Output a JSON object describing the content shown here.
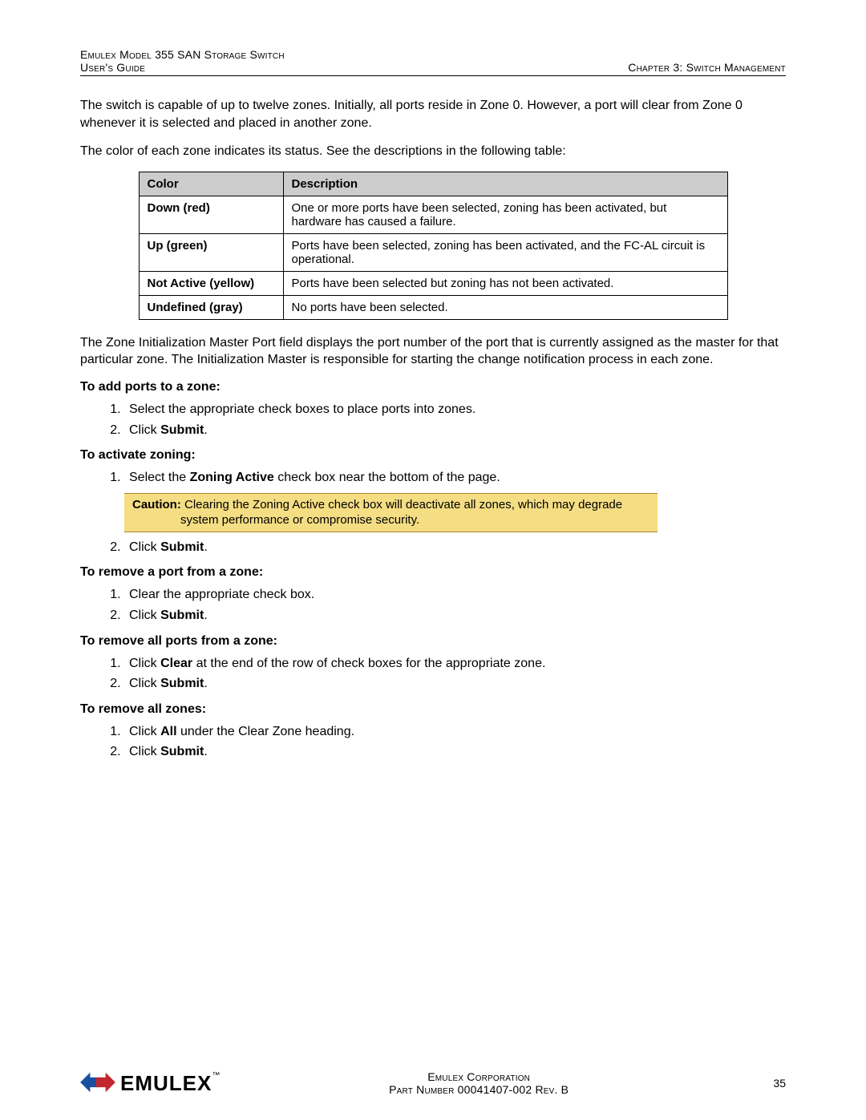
{
  "header": {
    "left_line1": "Emulex Model 355 SAN Storage Switch",
    "left_line2": "User's Guide",
    "right": "Chapter 3: Switch Management"
  },
  "intro_para1": "The switch is capable of up to twelve zones. Initially, all ports reside in Zone 0. However, a port will clear from Zone 0 whenever it is selected and placed in another zone.",
  "intro_para2": "The color of each zone indicates its status. See the descriptions in the following table:",
  "table": {
    "head": {
      "c1": "Color",
      "c2": "Description"
    },
    "rows": [
      {
        "color": "Down (red)",
        "desc": "One or more ports have been selected, zoning has been activated, but hardware has caused a failure."
      },
      {
        "color": "Up (green)",
        "desc": "Ports have been selected, zoning has been activated, and the FC-AL circuit is operational."
      },
      {
        "color": "Not Active (yellow)",
        "desc": "Ports have been selected but zoning has not been activated."
      },
      {
        "color": "Undefined (gray)",
        "desc": "No ports have been selected."
      }
    ]
  },
  "para_after_table": "The Zone Initialization Master Port field displays the port number of the port that is currently assigned as the master for that particular zone. The Initialization Master is responsible for starting the change notification process in each zone.",
  "proc1": {
    "title": "To add ports to a zone:",
    "steps": {
      "s1": "Select the appropriate check boxes to place ports into zones.",
      "s2_pre": "Click ",
      "s2_bold": "Submit",
      "s2_post": "."
    }
  },
  "proc2": {
    "title": "To activate zoning:",
    "steps": {
      "s1_pre": "Select the ",
      "s1_bold": "Zoning Active",
      "s1_post": " check box near the bottom of the page.",
      "caution_label": "Caution:",
      "caution_text1": " Clearing the Zoning Active check box will deactivate all zones, which may degrade",
      "caution_text2": "system performance or compromise security.",
      "s2_pre": "Click ",
      "s2_bold": "Submit",
      "s2_post": "."
    }
  },
  "proc3": {
    "title": "To remove a port from a zone:",
    "steps": {
      "s1": "Clear the appropriate check box.",
      "s2_pre": "Click ",
      "s2_bold": "Submit",
      "s2_post": "."
    }
  },
  "proc4": {
    "title": "To remove all ports from a zone:",
    "steps": {
      "s1_pre": "Click ",
      "s1_bold": "Clear",
      "s1_post": " at the end of the row of check boxes for the appropriate zone.",
      "s2_pre": "Click ",
      "s2_bold": "Submit",
      "s2_post": "."
    }
  },
  "proc5": {
    "title": "To remove all zones:",
    "steps": {
      "s1_pre": "Click ",
      "s1_bold": "All",
      "s1_post": " under the Clear Zone heading.",
      "s2_pre": "Click ",
      "s2_bold": "Submit",
      "s2_post": "."
    }
  },
  "footer": {
    "logo_text": "EMULEX",
    "tm": "™",
    "center_line1": "Emulex Corporation",
    "center_line2": "Part Number 00041407-002 Rev. B",
    "page_number": "35"
  }
}
